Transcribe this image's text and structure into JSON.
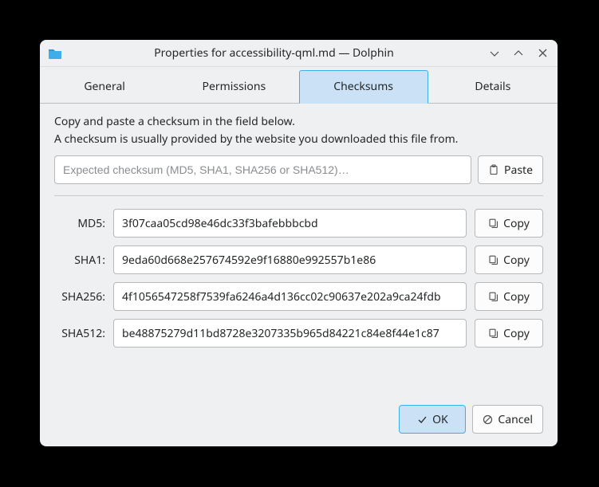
{
  "titlebar": {
    "title": "Properties for accessibility-qml.md — Dolphin"
  },
  "tabs": [
    {
      "label": "General",
      "active": false
    },
    {
      "label": "Permissions",
      "active": false
    },
    {
      "label": "Checksums",
      "active": true
    },
    {
      "label": "Details",
      "active": false
    }
  ],
  "instructions": {
    "line1": "Copy and paste a checksum in the field below.",
    "line2": "A checksum is usually provided by the website you downloaded this file from."
  },
  "expected": {
    "placeholder": "Expected checksum (MD5, SHA1, SHA256 or SHA512)…",
    "paste_label": "Paste"
  },
  "rows": {
    "md5": {
      "label": "MD5:",
      "value": "3f07caa05cd98e46dc33f3bafebbbcbd",
      "copy_label": "Copy"
    },
    "sha1": {
      "label": "SHA1:",
      "value": "9eda60d668e257674592e9f16880e992557b1e86",
      "copy_label": "Copy"
    },
    "sha256": {
      "label": "SHA256:",
      "value": "4f1056547258f7539fa6246a4d136cc02c90637e202a9ca24fdb",
      "copy_label": "Copy"
    },
    "sha512": {
      "label": "SHA512:",
      "value": "be48875279d11bd8728e3207335b965d84221c84e8f44e1c87",
      "copy_label": "Copy"
    }
  },
  "footer": {
    "ok_label": "OK",
    "cancel_label": "Cancel"
  }
}
